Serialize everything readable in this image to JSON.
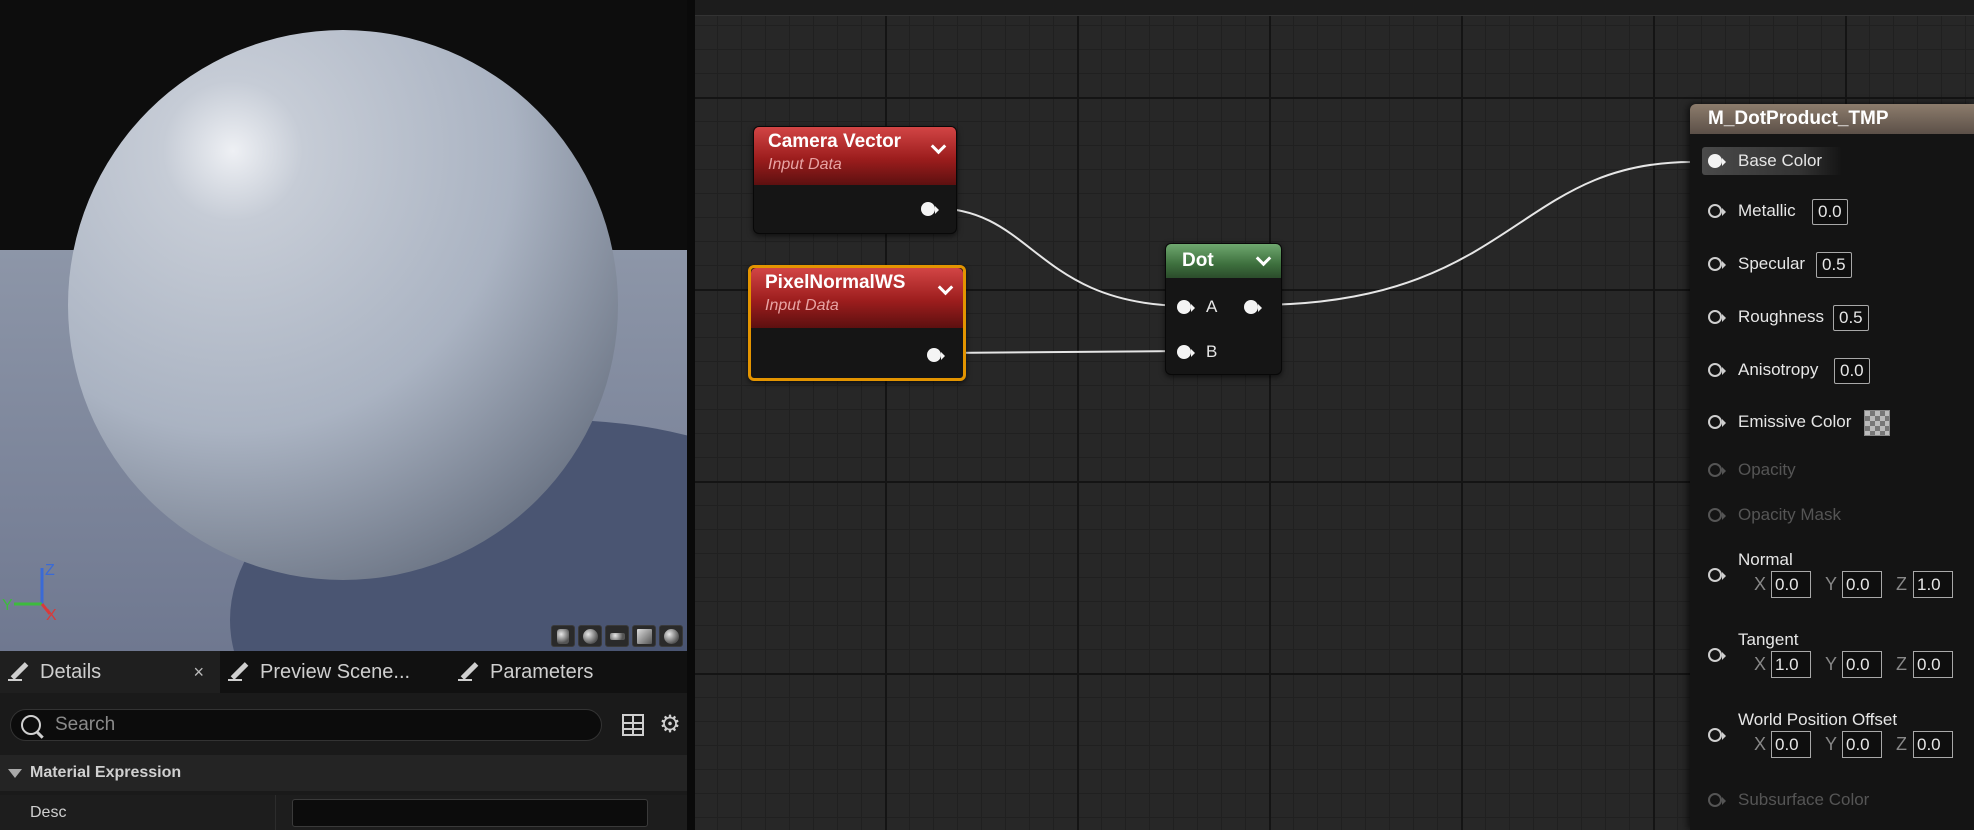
{
  "viewport": {
    "axis_labels": {
      "z": "Z",
      "y": "Y",
      "x": "X"
    },
    "preview_buttons": [
      "cylinder-icon",
      "sphere-icon",
      "plane-icon",
      "cube-icon",
      "teapot-icon"
    ]
  },
  "details_panel": {
    "tabs": [
      {
        "label": "Details",
        "close": "×"
      },
      {
        "label": "Preview Scene..."
      },
      {
        "label": "Parameters"
      }
    ],
    "search_placeholder": "Search",
    "section_title": "Material Expression",
    "properties": [
      {
        "label": "Desc",
        "value": ""
      }
    ]
  },
  "graph": {
    "nodes": {
      "camera_vector": {
        "title": "Camera Vector",
        "subtitle": "Input Data"
      },
      "pixel_normal": {
        "title": "PixelNormalWS",
        "subtitle": "Input Data"
      },
      "dot": {
        "title": "Dot",
        "pin_a": "A",
        "pin_b": "B"
      }
    },
    "result": {
      "title": "M_DotProduct_TMP",
      "inputs": {
        "base_color": "Base Color",
        "metallic": {
          "label": "Metallic",
          "value": "0.0"
        },
        "specular": {
          "label": "Specular",
          "value": "0.5"
        },
        "roughness": {
          "label": "Roughness",
          "value": "0.5"
        },
        "anisotropy": {
          "label": "Anisotropy",
          "value": "0.0"
        },
        "emissive": "Emissive Color",
        "opacity": "Opacity",
        "opacity_mask": "Opacity Mask",
        "normal": {
          "label": "Normal",
          "x": "0.0",
          "y": "0.0",
          "z": "1.0"
        },
        "tangent": {
          "label": "Tangent",
          "x": "1.0",
          "y": "0.0",
          "z": "0.0"
        },
        "wpo": {
          "label": "World Position Offset",
          "x": "0.0",
          "y": "0.0",
          "z": "0.0"
        },
        "subsurface": "Subsurface Color"
      },
      "component_labels": {
        "x": "X",
        "y": "Y",
        "z": "Z"
      }
    }
  },
  "colors": {
    "input_node_header": "#b52a2a",
    "math_node_header": "#4e8a4e",
    "selection_outline": "#e39400",
    "result_header": "#7a6c60"
  }
}
